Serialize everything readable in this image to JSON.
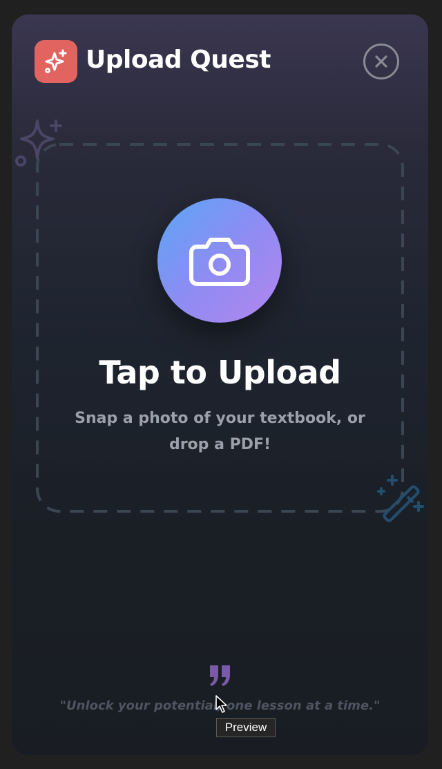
{
  "header": {
    "app_icon": "sparkles-icon",
    "title": "Upload Quest",
    "close_icon": "close-circle-icon"
  },
  "dropzone": {
    "icon": "camera-icon",
    "title": "Tap to Upload",
    "subtitle_line1": "Snap a photo of your textbook, or",
    "subtitle_line2": "drop a PDF!"
  },
  "decorations": {
    "top_left": "sparkle-icon",
    "bottom_right": "magic-wand-icon"
  },
  "footer": {
    "quote_icon": "quote-icon",
    "quote": "\"Unlock your potential, one lesson at a time.\""
  },
  "tooltip": {
    "label": "Preview"
  },
  "colors": {
    "accent": "#e26461",
    "camera_gradient_start": "#5aa6f4",
    "camera_gradient_end": "#b486ee",
    "quote_mark": "#7a5aa8"
  }
}
